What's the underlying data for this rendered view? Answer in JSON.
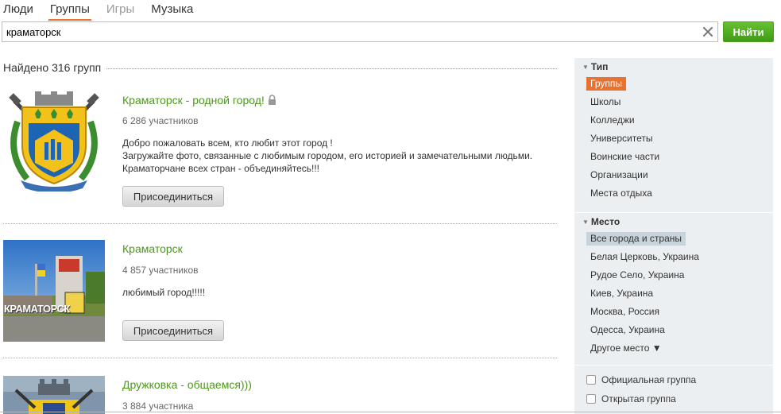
{
  "tabs": [
    {
      "label": "Люди",
      "state": "normal"
    },
    {
      "label": "Группы",
      "state": "active"
    },
    {
      "label": "Игры",
      "state": "muted"
    },
    {
      "label": "Музыка",
      "state": "normal"
    }
  ],
  "search": {
    "value": "краматорск",
    "button_label": "Найти"
  },
  "results": {
    "found_label": "Найдено 316 групп",
    "groups": [
      {
        "title": "Краматорск - родной город!",
        "locked": true,
        "members": "6 286 участников",
        "description": [
          "Добро пожаловать всем, кто любит этот город !",
          "Загружайте фото, связанные с любимым городом, его историей и замечательными людьми.",
          "Краматорчане всех стран - объединяйтесь!!!"
        ],
        "join_label": "Присоединиться",
        "image": "kramatorsk-coat-of-arms"
      },
      {
        "title": "Краматорск",
        "locked": false,
        "members": "4 857 участников",
        "description": [
          "любимый город!!!!!"
        ],
        "join_label": "Присоединиться",
        "image": "kramatorsk-city-sign-photo",
        "image_text": "КРАМАТОРСК"
      },
      {
        "title": "Дружковка - общаемся)))",
        "locked": false,
        "members": "3 884 участника",
        "image": "druzhkovka-coat-of-arms"
      }
    ]
  },
  "sidebar": {
    "type_section": {
      "heading": "Тип",
      "items": [
        "Группы",
        "Школы",
        "Колледжи",
        "Университеты",
        "Воинские части",
        "Организации",
        "Места отдыха"
      ],
      "selected": "Группы"
    },
    "place_section": {
      "heading": "Место",
      "items": [
        "Все города и страны",
        "Белая Церковь, Украина",
        "Рудое Село, Украина",
        "Киев, Украина",
        "Москва, Россия",
        "Одесса, Украина",
        "Другое место ▼"
      ],
      "selected": "Все города и страны"
    },
    "checkboxes": [
      "Официальная группа",
      "Открытая группа"
    ]
  },
  "colors": {
    "accent_orange": "#eb722e",
    "link_green": "#4a9a17",
    "button_green": "#3f9b12",
    "sidebar_bg": "#eceff1"
  }
}
